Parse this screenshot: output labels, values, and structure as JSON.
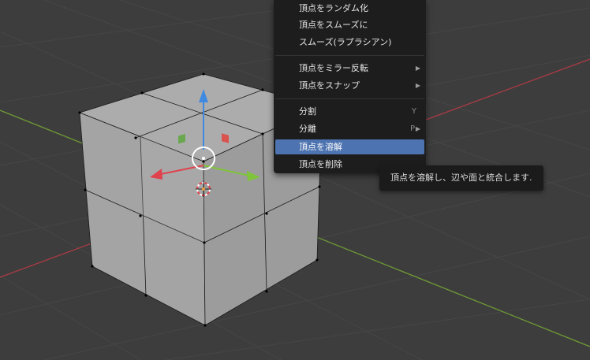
{
  "menu": {
    "items": [
      {
        "label": "頂点をランダム化"
      },
      {
        "label": "頂点をスムーズに"
      },
      {
        "label": "スムーズ(ラプラシアン)"
      },
      {
        "label": "頂点をミラー反転",
        "submenu": "▶"
      },
      {
        "label": "頂点をスナップ",
        "submenu": "▶"
      },
      {
        "label": "分割",
        "shortcut": "Y"
      },
      {
        "label": "分離",
        "shortcut": "P",
        "submenu": "▶"
      },
      {
        "label": "頂点を溶解",
        "active": true
      },
      {
        "label": "頂点を削除"
      }
    ]
  },
  "tooltip": {
    "text": "頂点を溶解し、辺や面と統合します."
  },
  "colors": {
    "background": "#3d3d3d",
    "menu_background": "#1d1d1d",
    "highlight": "#4d73b0",
    "axis_x": "#a83b44",
    "axis_y": "#6f9a35",
    "gizmo_z": "#3f8ae0",
    "gizmo_x": "#e0424d",
    "gizmo_y": "#7fc43a"
  },
  "icons": [
    "move-gizmo-icon",
    "3d-cursor-icon"
  ]
}
